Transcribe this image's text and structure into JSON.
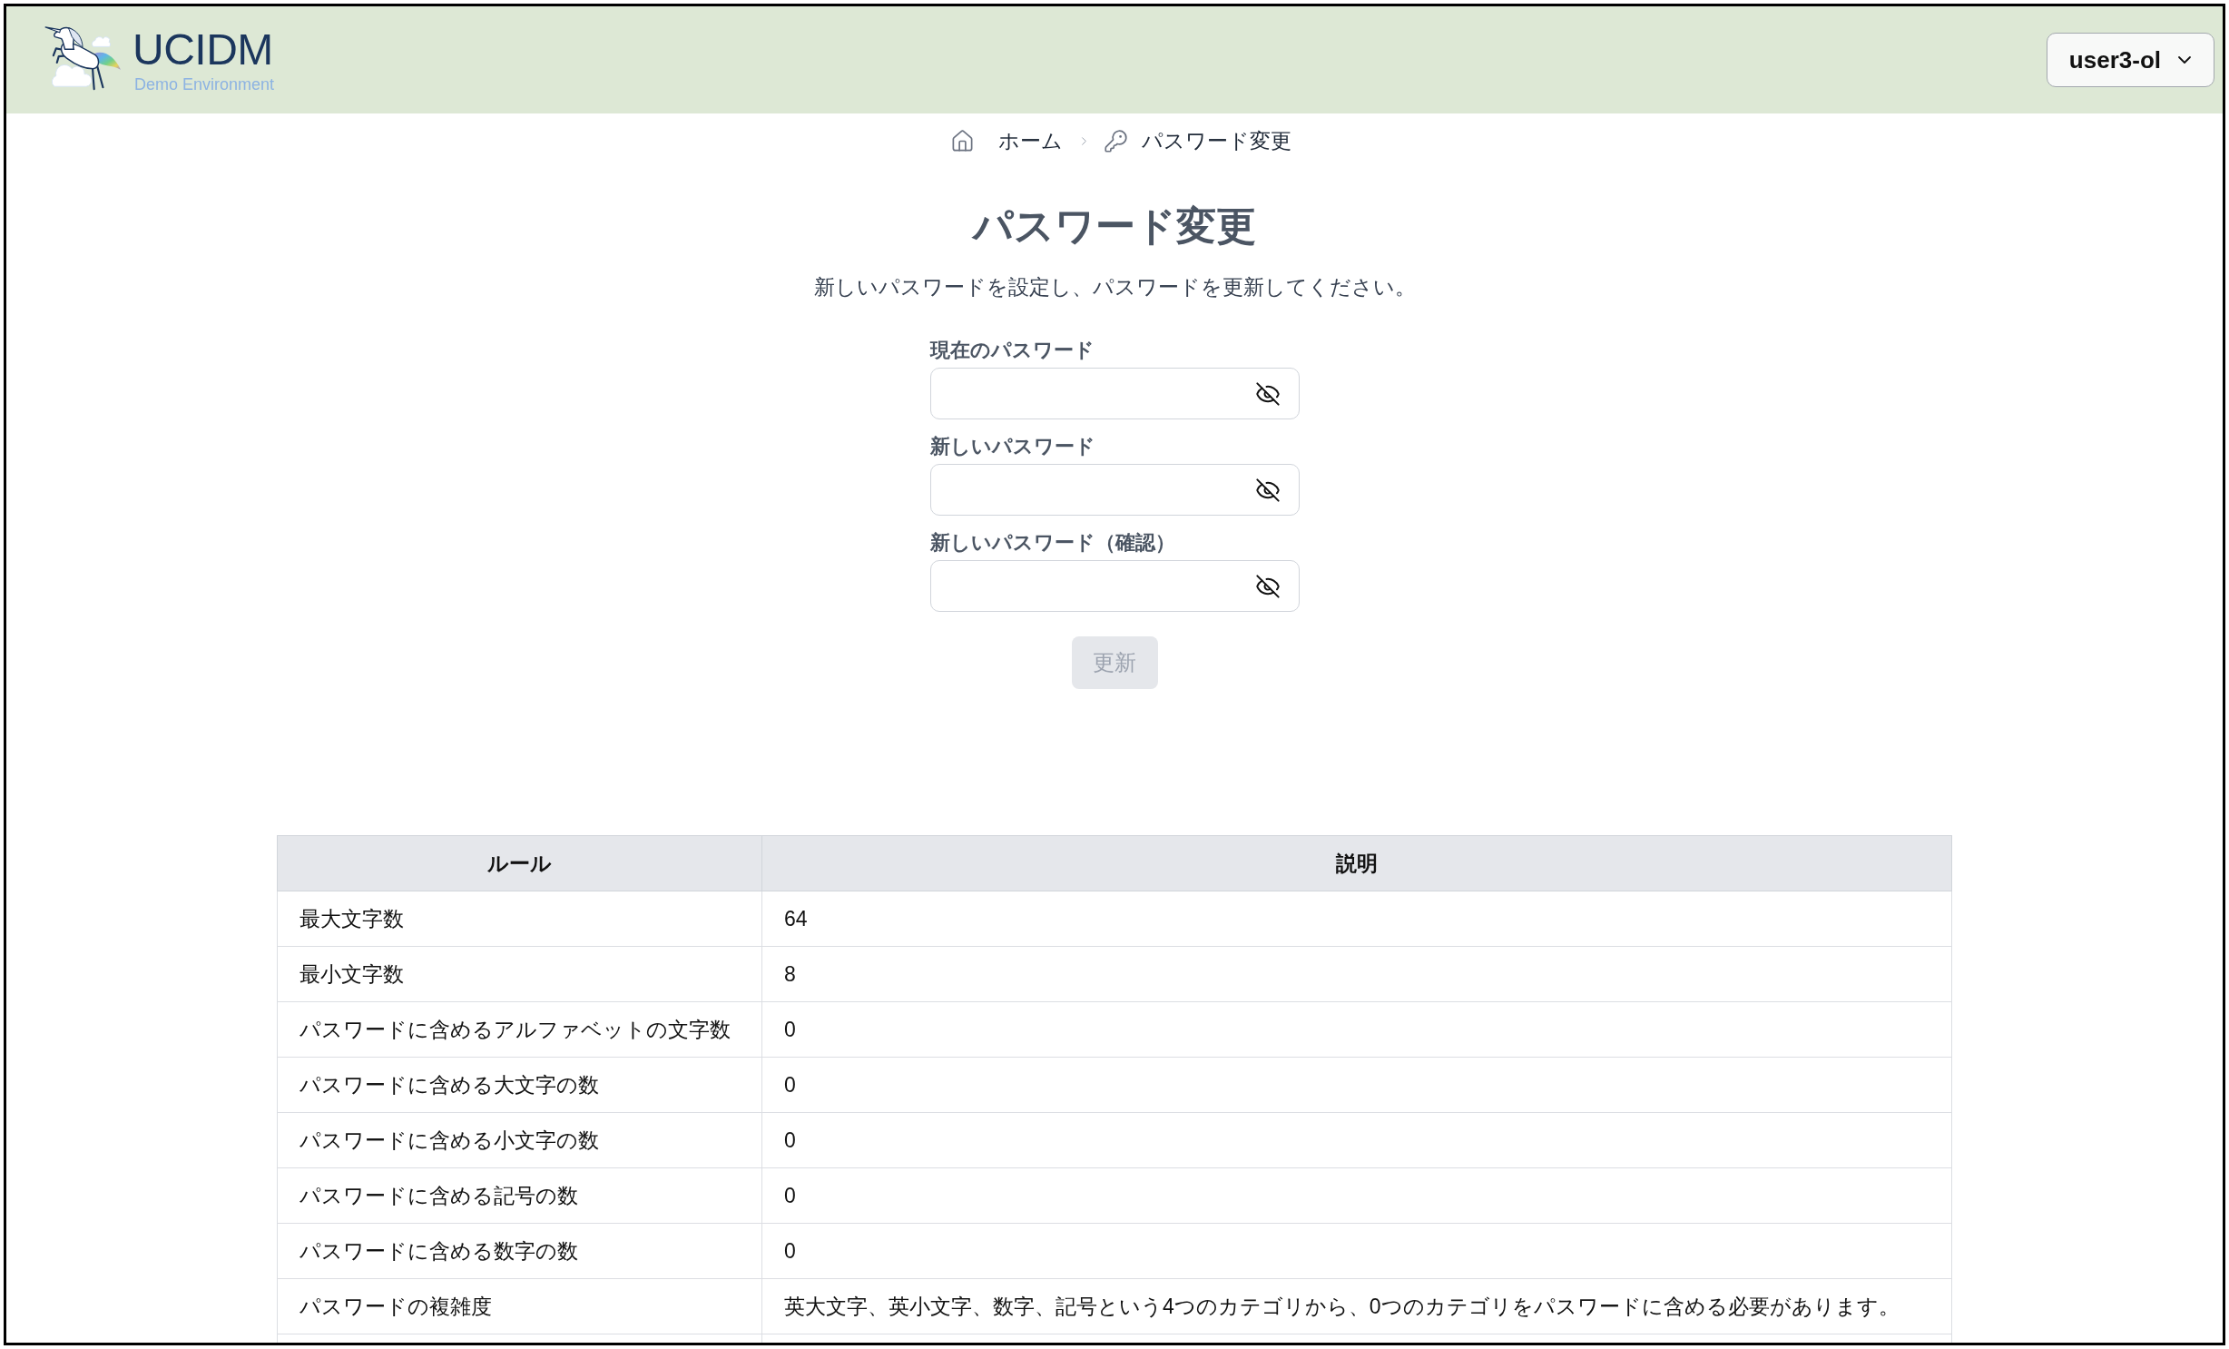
{
  "header": {
    "logo": {
      "name": "UCIDM",
      "subtitle": "Demo Environment"
    },
    "user_menu": {
      "label": "user3-ol"
    }
  },
  "breadcrumb": [
    {
      "kind": "home",
      "label": "ホーム"
    },
    {
      "kind": "key",
      "label": "パスワード変更"
    }
  ],
  "page": {
    "title": "パスワード変更",
    "description": "新しいパスワードを設定し、パスワードを更新してください。"
  },
  "form": {
    "fields": [
      {
        "label": "現在のパスワード",
        "password_visible": false
      },
      {
        "label": "新しいパスワード",
        "password_visible": false
      },
      {
        "label": "新しいパスワード（確認）",
        "password_visible": false
      }
    ],
    "submit": {
      "label": "更新",
      "disabled": true
    }
  },
  "table": {
    "columns": [
      "ルール",
      "説明"
    ],
    "rows": [
      [
        "最大文字数",
        "64"
      ],
      [
        "最小文字数",
        "8"
      ],
      [
        "パスワードに含めるアルファベットの文字数",
        "0"
      ],
      [
        "パスワードに含める大文字の数",
        "0"
      ],
      [
        "パスワードに含める小文字の数",
        "0"
      ],
      [
        "パスワードに含める記号の数",
        "0"
      ],
      [
        "パスワードに含める数字の数",
        "0"
      ],
      [
        "パスワードの複雑度",
        "英大文字、英小文字、数字、記号という4つのカテゴリから、0つのカテゴリをパスワードに含める必要があります。"
      ]
    ]
  }
}
